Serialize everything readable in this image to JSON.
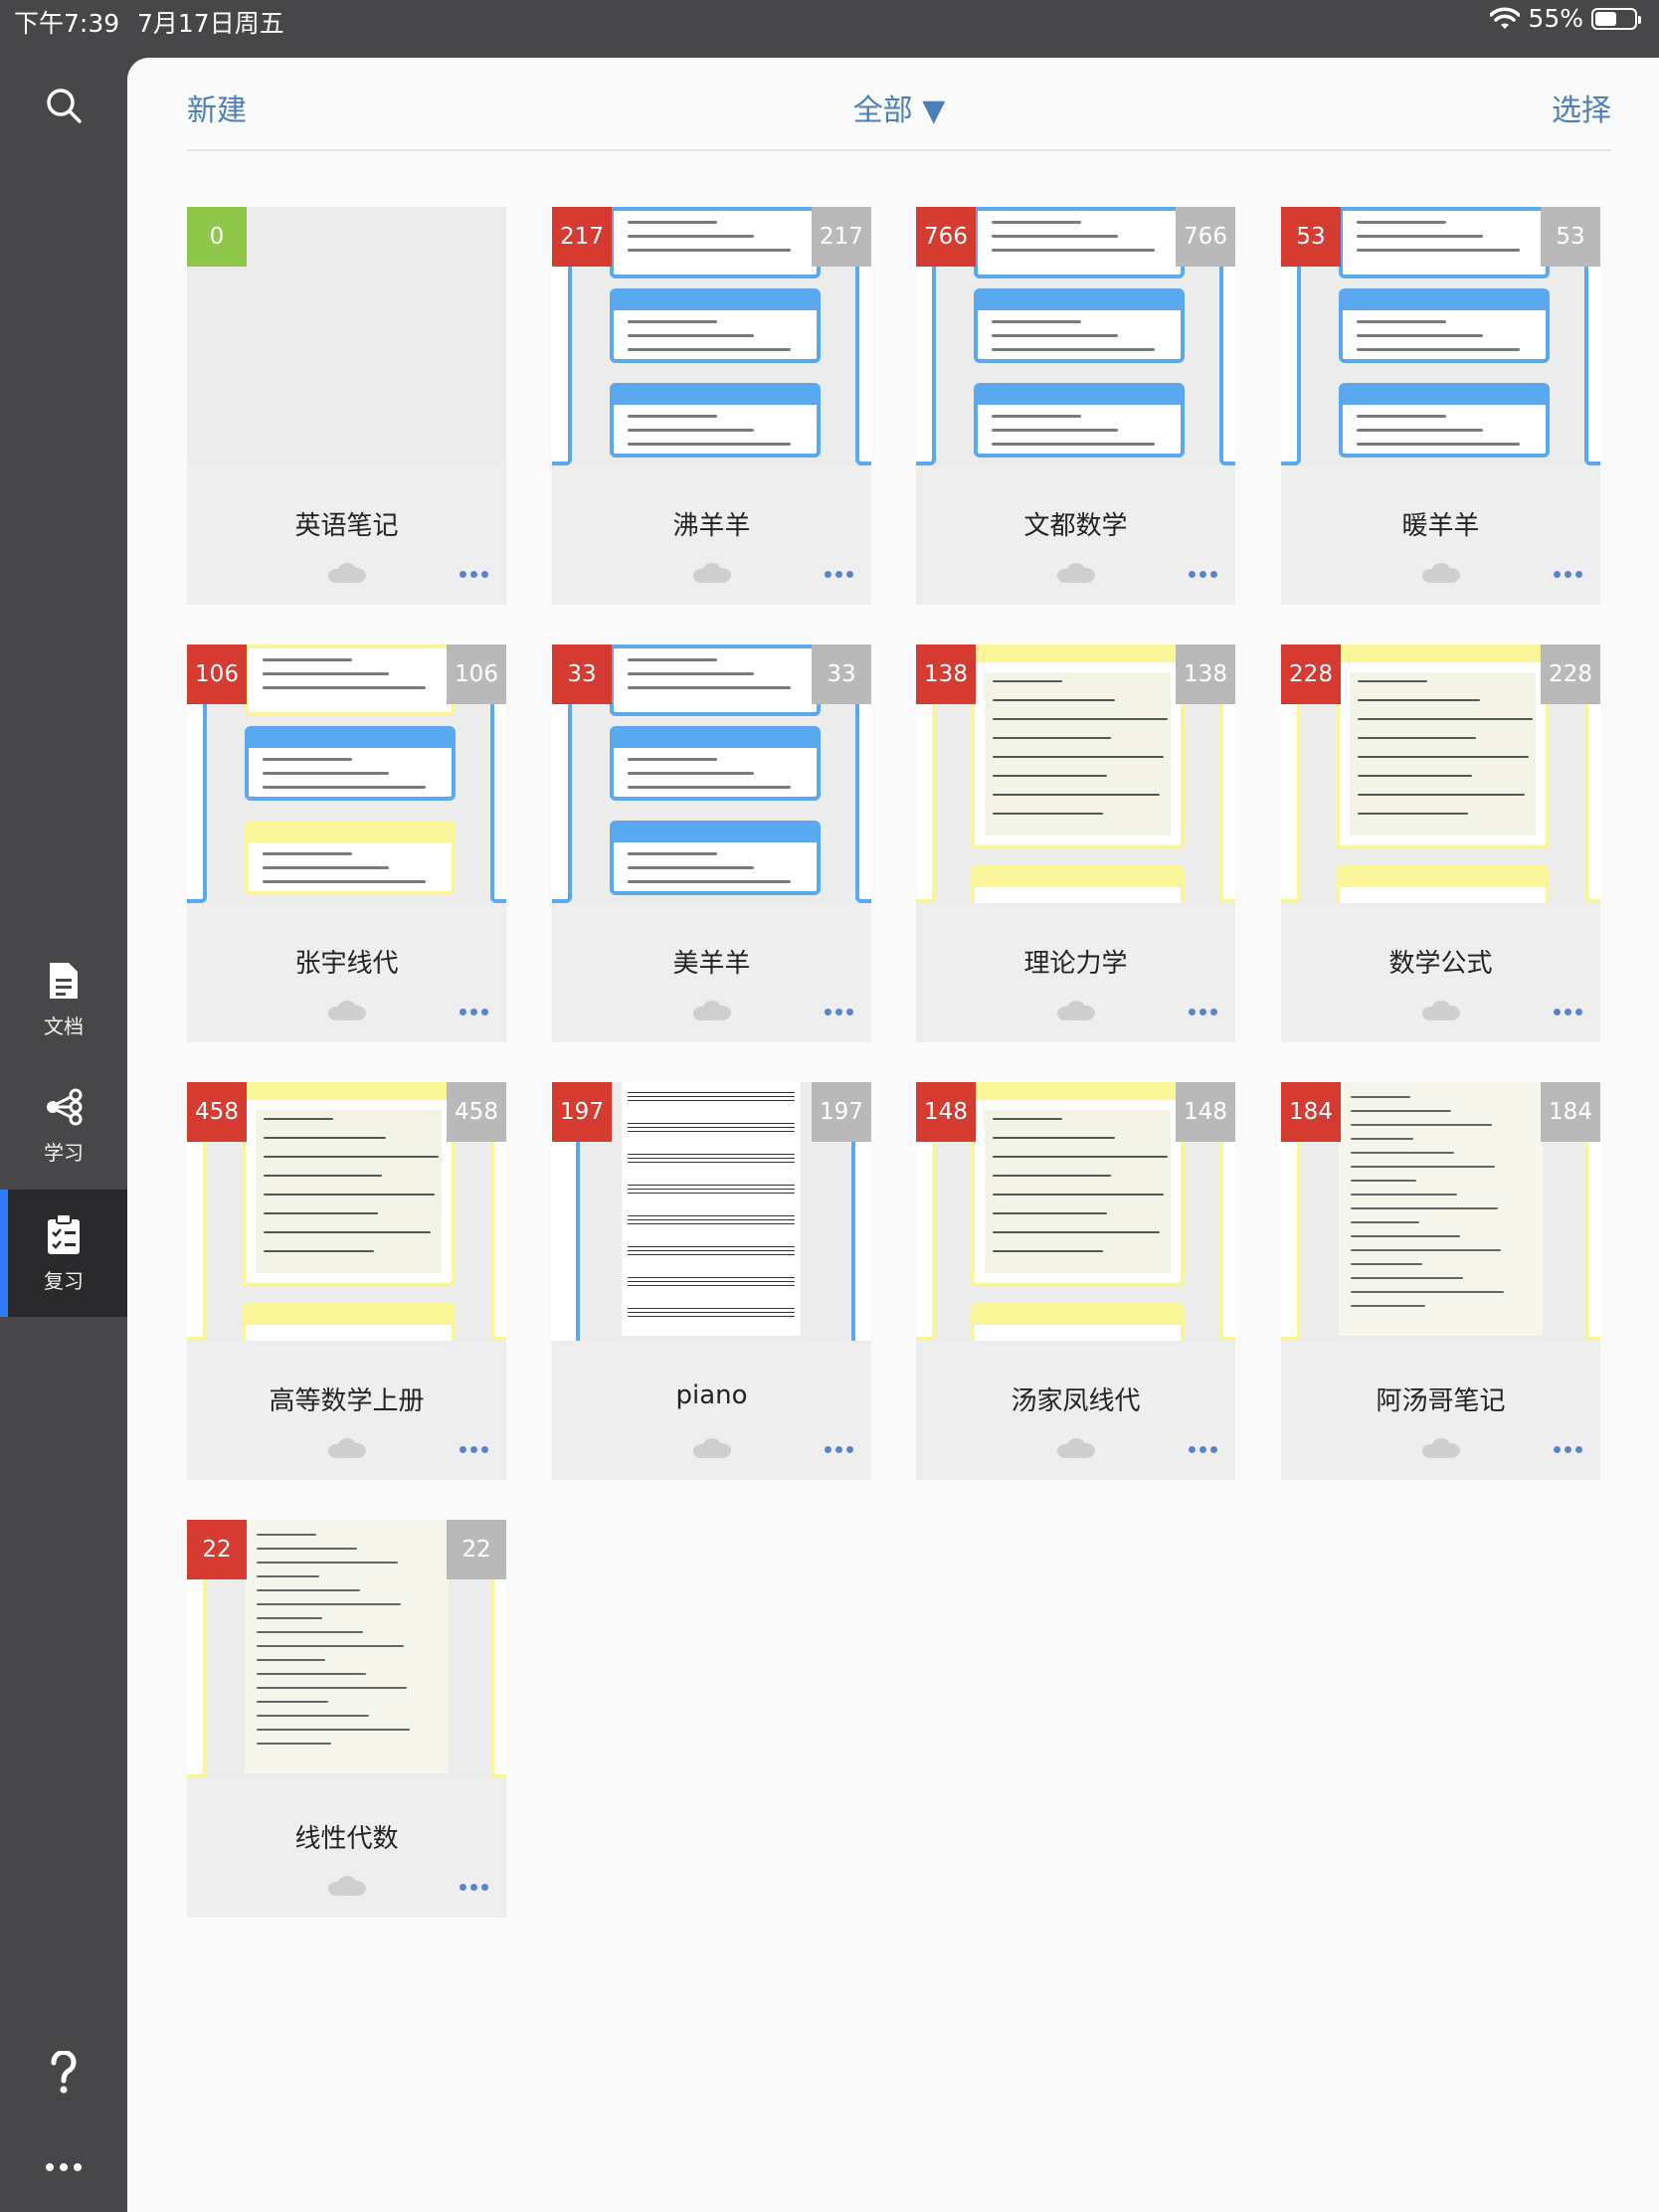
{
  "status": {
    "time": "下午7:39",
    "date": "7月17日周五",
    "battery": "55%",
    "battery_level": 0.55
  },
  "sidebar": {
    "docs_label": "文档",
    "study_label": "学习",
    "review_label": "复习"
  },
  "toolbar": {
    "new_label": "新建",
    "filter_label": "全部 ▼",
    "select_label": "选择"
  },
  "colors": {
    "accent": "#4a7fb8",
    "badge_red": "#d63b32",
    "badge_green": "#8fc74a",
    "badge_gray": "#b9b9b9"
  },
  "notebooks": [
    {
      "title": "英语笔记",
      "left": "0",
      "right": "",
      "badge": "green",
      "style": "empty"
    },
    {
      "title": "沸羊羊",
      "left": "217",
      "right": "217",
      "badge": "red",
      "style": "blue"
    },
    {
      "title": "文都数学",
      "left": "766",
      "right": "766",
      "badge": "red",
      "style": "blue"
    },
    {
      "title": "暖羊羊",
      "left": "53",
      "right": "53",
      "badge": "red",
      "style": "blue"
    },
    {
      "title": "张宇线代",
      "left": "106",
      "right": "106",
      "badge": "red",
      "style": "yellowblue"
    },
    {
      "title": "美羊羊",
      "left": "33",
      "right": "33",
      "badge": "red",
      "style": "blue"
    },
    {
      "title": "理论力学",
      "left": "138",
      "right": "138",
      "badge": "red",
      "style": "yellow"
    },
    {
      "title": "数学公式",
      "left": "228",
      "right": "228",
      "badge": "red",
      "style": "yellow"
    },
    {
      "title": "高等数学上册",
      "left": "458",
      "right": "458",
      "badge": "red",
      "style": "yellow"
    },
    {
      "title": "piano",
      "left": "197",
      "right": "197",
      "badge": "red",
      "style": "piano"
    },
    {
      "title": "汤家凤线代",
      "left": "148",
      "right": "148",
      "badge": "red",
      "style": "yellow"
    },
    {
      "title": "阿汤哥笔记",
      "left": "184",
      "right": "184",
      "badge": "red",
      "style": "page"
    },
    {
      "title": "线性代数",
      "left": "22",
      "right": "22",
      "badge": "red",
      "style": "page"
    }
  ]
}
